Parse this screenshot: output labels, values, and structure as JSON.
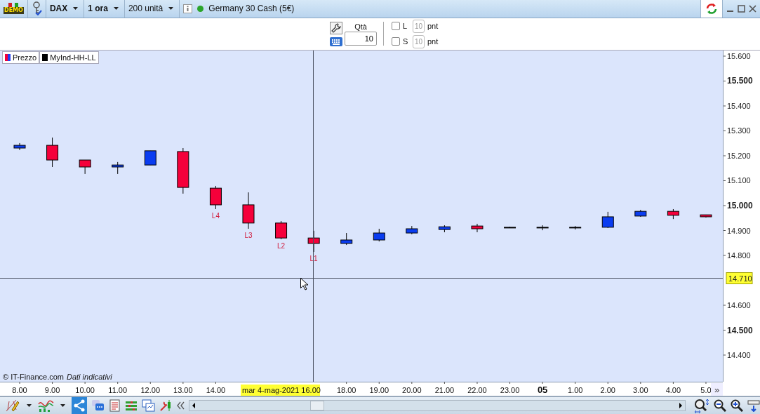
{
  "toolbar": {
    "logo_text": "DEMO",
    "dropdowns": [
      {
        "label": "DAX"
      },
      {
        "label": "1 ora"
      },
      {
        "label": "200 unità"
      }
    ],
    "instrument": "Germany 30 Cash (5€)"
  },
  "order_panel": {
    "qty_label": "Qtà",
    "qty_value": "10",
    "stops": [
      {
        "label": "L",
        "checked": false,
        "value": "10",
        "unit": "pnt"
      },
      {
        "label": "S",
        "checked": false,
        "value": "10",
        "unit": "pnt"
      }
    ]
  },
  "chart": {
    "legend": [
      {
        "kind": "price",
        "label": "Prezzo"
      },
      {
        "kind": "indicator",
        "label": "MyInd-HH-LL"
      }
    ],
    "copyright": "© IT-Finance.com",
    "notice": "Dati indicativi",
    "crosshair": {
      "price": "14.710",
      "time": "mar 4-mag-2021 16.00"
    },
    "scroll_right": "»",
    "chart_data": {
      "type": "candlestick",
      "ylim": [
        14.293,
        15.6225
      ],
      "yticks": [
        {
          "value": 15.6,
          "label": "15.600"
        },
        {
          "value": 15.5,
          "label": "15.500"
        },
        {
          "value": 15.4,
          "label": "15.400"
        },
        {
          "value": 15.3,
          "label": "15.300"
        },
        {
          "value": 15.2,
          "label": "15.200"
        },
        {
          "value": 15.1,
          "label": "15.100"
        },
        {
          "value": 15.0,
          "label": "15.000"
        },
        {
          "value": 14.9,
          "label": "14.900"
        },
        {
          "value": 14.8,
          "label": "14.800"
        },
        {
          "value": 14.6,
          "label": "14.600"
        },
        {
          "value": 14.5,
          "label": "14.500"
        },
        {
          "value": 14.4,
          "label": "14.400"
        }
      ],
      "categories": [
        "8.00",
        "9.00",
        "10.00",
        "11.00",
        "12.00",
        "13.00",
        "14.00",
        null,
        null,
        null,
        "18.00",
        "19.00",
        "20.00",
        "21.00",
        "22.00",
        "23.00",
        "05",
        "1.00",
        "2.00",
        "3.00",
        "4.00",
        "5.0"
      ],
      "ohlc": [
        [
          15.231,
          15.251,
          15.223,
          15.242
        ],
        [
          15.242,
          15.273,
          15.155,
          15.183
        ],
        [
          15.183,
          15.183,
          15.127,
          15.155
        ],
        [
          15.155,
          15.175,
          15.127,
          15.163
        ],
        [
          15.163,
          15.22,
          15.163,
          15.22
        ],
        [
          15.217,
          15.231,
          15.048,
          15.073
        ],
        [
          15.07,
          15.079,
          14.986,
          15.003
        ],
        [
          15.003,
          15.053,
          14.907,
          14.93
        ],
        [
          14.93,
          14.938,
          14.865,
          14.87
        ],
        [
          14.87,
          14.899,
          14.814,
          14.848
        ],
        [
          14.848,
          14.89,
          14.842,
          14.862
        ],
        [
          14.862,
          14.907,
          14.856,
          14.89
        ],
        [
          14.89,
          14.918,
          14.885,
          14.907
        ],
        [
          14.904,
          14.921,
          14.893,
          14.915
        ],
        [
          14.918,
          14.927,
          14.893,
          14.907
        ],
        [
          14.913,
          14.915,
          14.91,
          14.913
        ],
        [
          14.913,
          14.921,
          14.901,
          14.913
        ],
        [
          14.913,
          14.918,
          14.904,
          14.913
        ],
        [
          14.913,
          14.975,
          14.91,
          14.955
        ],
        [
          14.958,
          14.983,
          14.955,
          14.977
        ],
        [
          14.977,
          14.986,
          14.946,
          14.961
        ],
        [
          14.963,
          14.963,
          14.952,
          14.955
        ]
      ],
      "annotations": [
        "L4",
        "L3",
        "L2",
        "L1"
      ]
    }
  }
}
